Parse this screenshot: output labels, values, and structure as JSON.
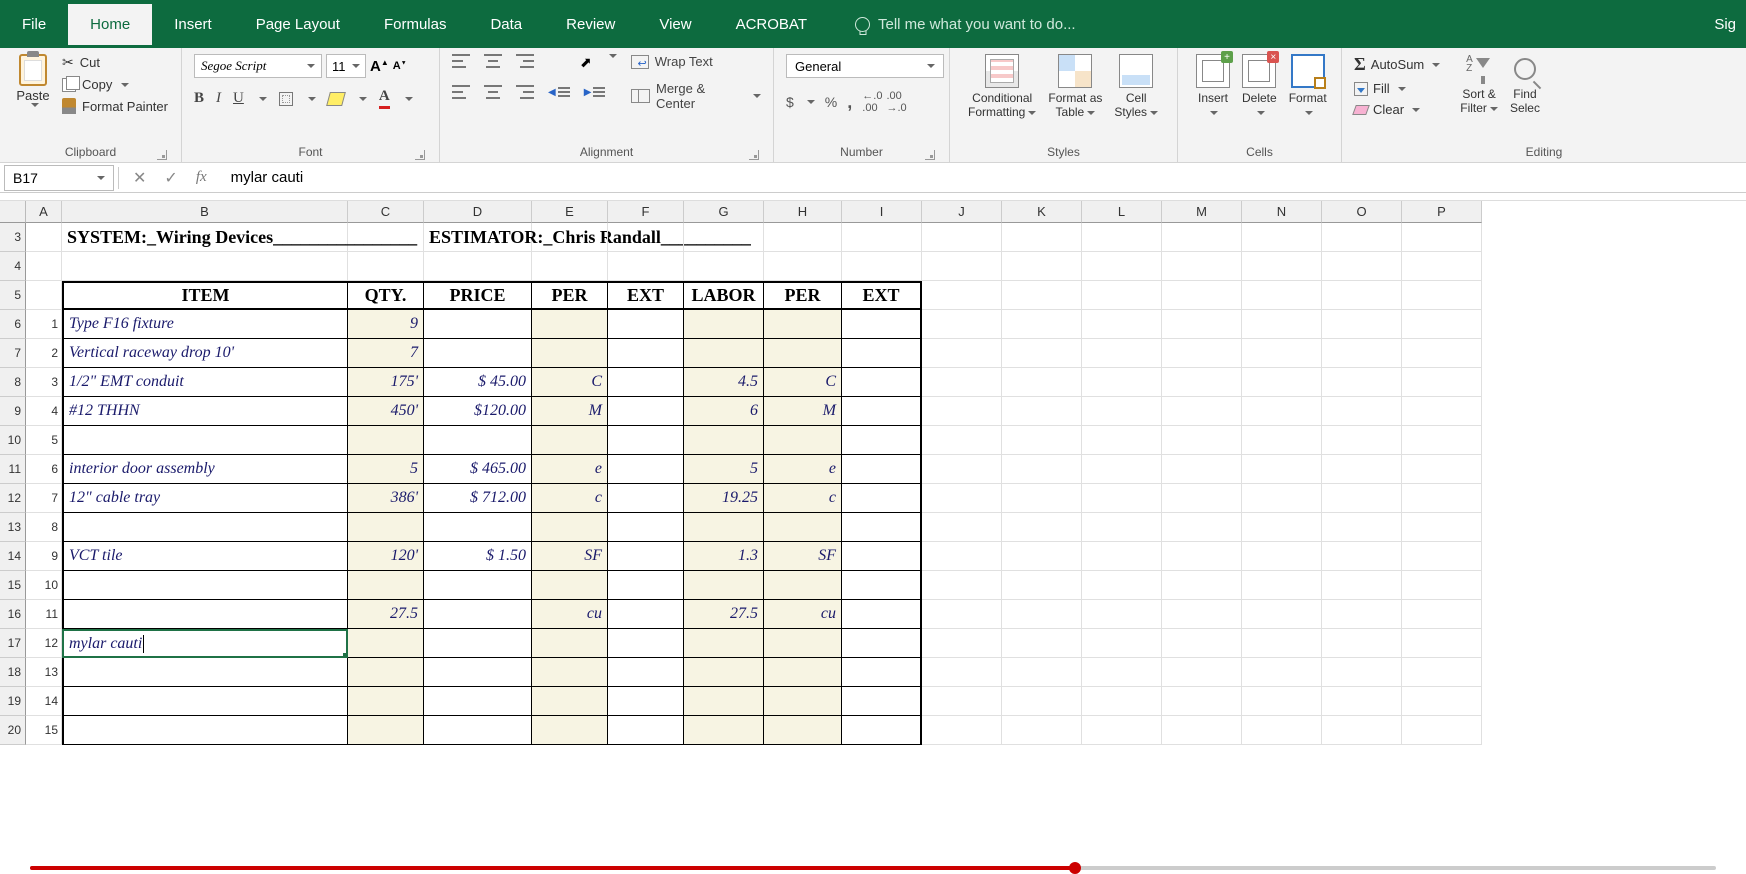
{
  "tabs": {
    "file": "File",
    "home": "Home",
    "insert": "Insert",
    "page_layout": "Page Layout",
    "formulas": "Formulas",
    "data": "Data",
    "review": "Review",
    "view": "View",
    "acrobat": "ACROBAT"
  },
  "tell_me": "Tell me what you want to do...",
  "sig": "Sig",
  "ribbon": {
    "clipboard": {
      "label": "Clipboard",
      "paste": "Paste",
      "cut": "Cut",
      "copy": "Copy",
      "fp": "Format Painter"
    },
    "font": {
      "label": "Font",
      "name": "Segoe Script",
      "size": "11"
    },
    "alignment": {
      "label": "Alignment",
      "wrap": "Wrap Text",
      "merge": "Merge & Center"
    },
    "number": {
      "label": "Number",
      "combo": "General",
      "dollar": "$",
      "pct": "%",
      "comma": ",",
      "d1": ".0",
      "d2": ".00"
    },
    "styles": {
      "label": "Styles",
      "cf1": "Conditional",
      "cf2": "Formatting",
      "fat1": "Format as",
      "fat2": "Table",
      "cs1": "Cell",
      "cs2": "Styles"
    },
    "cells": {
      "label": "Cells",
      "ins": "Insert",
      "del": "Delete",
      "fmt": "Format"
    },
    "editing": {
      "label": "Editing",
      "sum": "AutoSum",
      "fill": "Fill",
      "clear": "Clear",
      "sf1": "Sort &",
      "sf2": "Filter",
      "fs1": "Find",
      "fs2": "Selec"
    }
  },
  "name_box": "B17",
  "formula": "mylar cauti",
  "cols": [
    "A",
    "B",
    "C",
    "D",
    "E",
    "F",
    "G",
    "H",
    "I",
    "J",
    "K",
    "L",
    "M",
    "N",
    "O",
    "P"
  ],
  "row_nums": [
    "3",
    "4",
    "5",
    "6",
    "7",
    "8",
    "9",
    "10",
    "11",
    "12",
    "13",
    "14",
    "15",
    "16",
    "17",
    "18",
    "19",
    "20"
  ],
  "sheet": {
    "system_label": "SYSTEM:_Wiring Devices________________",
    "estimator_label": "ESTIMATOR:_Chris Randall__________",
    "headers": {
      "item": "ITEM",
      "qty": "QTY.",
      "price": "PRICE",
      "per": "PER",
      "ext": "EXT",
      "labor": "LABOR",
      "per2": "PER",
      "ext2": "EXT"
    },
    "rows": [
      {
        "n": "1",
        "item": "Type F16 fixture",
        "qty": "9",
        "price": "",
        "per": "",
        "ext": "",
        "labor": "",
        "per2": "",
        "ext2": ""
      },
      {
        "n": "2",
        "item": "Vertical raceway drop 10'",
        "qty": "7",
        "price": "",
        "per": "",
        "ext": "",
        "labor": "",
        "per2": "",
        "ext2": ""
      },
      {
        "n": "3",
        "item": "1/2\" EMT conduit",
        "qty": "175'",
        "price": "$   45.00",
        "per": "C",
        "ext": "",
        "labor": "4.5",
        "per2": "C",
        "ext2": ""
      },
      {
        "n": "4",
        "item": "#12 THHN",
        "qty": "450'",
        "price": "$120.00",
        "per": "M",
        "ext": "",
        "labor": "6",
        "per2": "M",
        "ext2": ""
      },
      {
        "n": "5",
        "item": "",
        "qty": "",
        "price": "",
        "per": "",
        "ext": "",
        "labor": "",
        "per2": "",
        "ext2": ""
      },
      {
        "n": "6",
        "item": "interior door assembly",
        "qty": "5",
        "price": "$ 465.00",
        "per": "e",
        "ext": "",
        "labor": "5",
        "per2": "e",
        "ext2": ""
      },
      {
        "n": "7",
        "item": "12\" cable tray",
        "qty": "386'",
        "price": "$ 712.00",
        "per": "c",
        "ext": "",
        "labor": "19.25",
        "per2": "c",
        "ext2": ""
      },
      {
        "n": "8",
        "item": "",
        "qty": "",
        "price": "",
        "per": "",
        "ext": "",
        "labor": "",
        "per2": "",
        "ext2": ""
      },
      {
        "n": "9",
        "item": "VCT tile",
        "qty": "120'",
        "price": "$      1.50",
        "per": "SF",
        "ext": "",
        "labor": "1.3",
        "per2": "SF",
        "ext2": ""
      },
      {
        "n": "10",
        "item": "",
        "qty": "",
        "price": "",
        "per": "",
        "ext": "",
        "labor": "",
        "per2": "",
        "ext2": ""
      },
      {
        "n": "11",
        "item": "",
        "qty": "27.5",
        "price": "",
        "per": "cu",
        "ext": "",
        "labor": "27.5",
        "per2": "cu",
        "ext2": ""
      },
      {
        "n": "12",
        "item": "mylar cauti",
        "qty": "",
        "price": "",
        "per": "",
        "ext": "",
        "labor": "",
        "per2": "",
        "ext2": ""
      },
      {
        "n": "13",
        "item": "",
        "qty": "",
        "price": "",
        "per": "",
        "ext": "",
        "labor": "",
        "per2": "",
        "ext2": ""
      },
      {
        "n": "14",
        "item": "",
        "qty": "",
        "price": "",
        "per": "",
        "ext": "",
        "labor": "",
        "per2": "",
        "ext2": ""
      },
      {
        "n": "15",
        "item": "",
        "qty": "",
        "price": "",
        "per": "",
        "ext": "",
        "labor": "",
        "per2": "",
        "ext2": ""
      }
    ]
  }
}
